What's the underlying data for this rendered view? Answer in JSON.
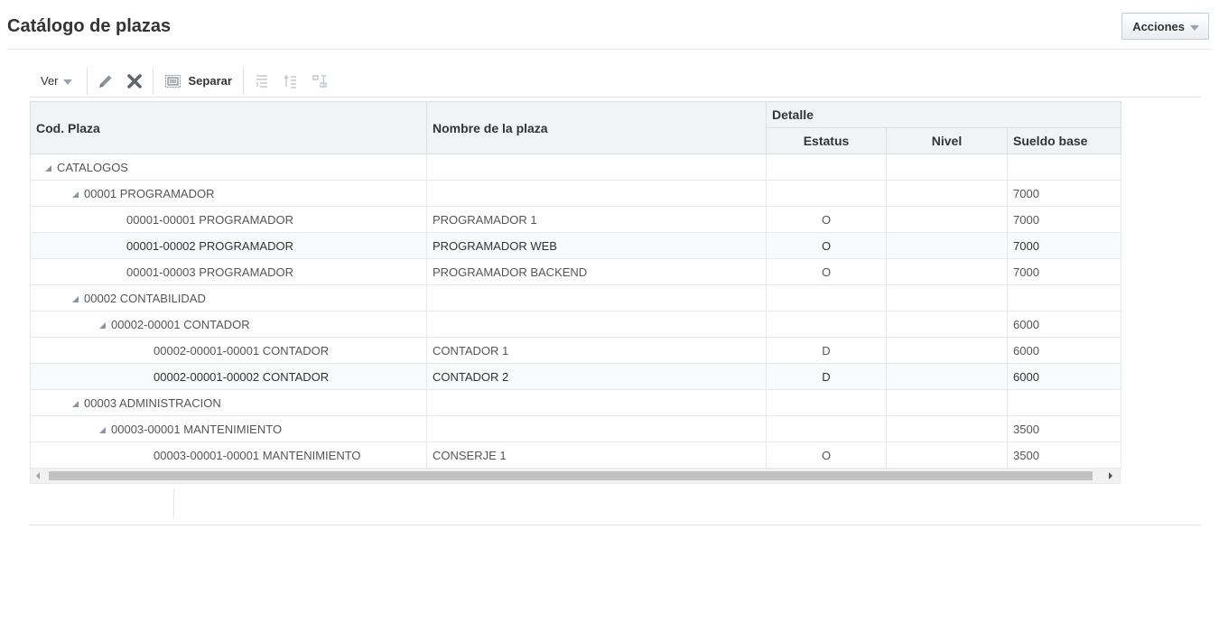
{
  "page": {
    "title": "Catálogo de plazas"
  },
  "actions": {
    "label": "Acciones"
  },
  "toolbar": {
    "view_label": "Ver",
    "detach_label": "Separar"
  },
  "table": {
    "headers": {
      "code": "Cod. Plaza",
      "name": "Nombre de la plaza",
      "detail_group": "Detalle",
      "status": "Estatus",
      "level": "Nivel",
      "salary": "Sueldo base"
    },
    "rows": [
      {
        "level": 0,
        "toggle": true,
        "code": "CATALOGOS",
        "name": "",
        "status": "",
        "nivel": "",
        "salary": ""
      },
      {
        "level": 1,
        "toggle": true,
        "code": "00001 PROGRAMADOR",
        "name": "",
        "status": "",
        "nivel": "",
        "salary": "7000"
      },
      {
        "level": 2,
        "toggle": false,
        "code": "00001-00001 PROGRAMADOR",
        "name": "PROGRAMADOR 1",
        "status": "O",
        "nivel": "",
        "salary": "7000"
      },
      {
        "level": 2,
        "toggle": false,
        "code": "00001-00002 PROGRAMADOR",
        "name": "PROGRAMADOR WEB",
        "status": "O",
        "nivel": "",
        "salary": "7000"
      },
      {
        "level": 2,
        "toggle": false,
        "code": "00001-00003 PROGRAMADOR",
        "name": "PROGRAMADOR BACKEND",
        "status": "O",
        "nivel": "",
        "salary": "7000"
      },
      {
        "level": 1,
        "toggle": true,
        "code": "00002 CONTABILIDAD",
        "name": "",
        "status": "",
        "nivel": "",
        "salary": ""
      },
      {
        "level": 2,
        "toggle": true,
        "code": "00002-00001 CONTADOR",
        "name": "",
        "status": "",
        "nivel": "",
        "salary": "6000"
      },
      {
        "level": 3,
        "toggle": false,
        "code": "00002-00001-00001 CONTADOR",
        "name": "CONTADOR 1",
        "status": "D",
        "nivel": "",
        "salary": "6000"
      },
      {
        "level": 3,
        "toggle": false,
        "code": "00002-00001-00002 CONTADOR",
        "name": "CONTADOR 2",
        "status": "D",
        "nivel": "",
        "salary": "6000"
      },
      {
        "level": 1,
        "toggle": true,
        "code": "00003 ADMINISTRACION",
        "name": "",
        "status": "",
        "nivel": "",
        "salary": ""
      },
      {
        "level": 2,
        "toggle": true,
        "code": "00003-00001 MANTENIMIENTO",
        "name": "",
        "status": "",
        "nivel": "",
        "salary": "3500"
      },
      {
        "level": 3,
        "toggle": false,
        "code": "00003-00001-00001 MANTENIMIENTO",
        "name": "CONSERJE 1",
        "status": "O",
        "nivel": "",
        "salary": "3500"
      }
    ]
  },
  "icons": {
    "edit": "pencil-icon",
    "delete": "x-icon",
    "detach": "detach-icon",
    "expand_all": "expand-all-icon",
    "collapse_all": "collapse-all-icon",
    "show_as_top": "show-as-top-icon"
  }
}
